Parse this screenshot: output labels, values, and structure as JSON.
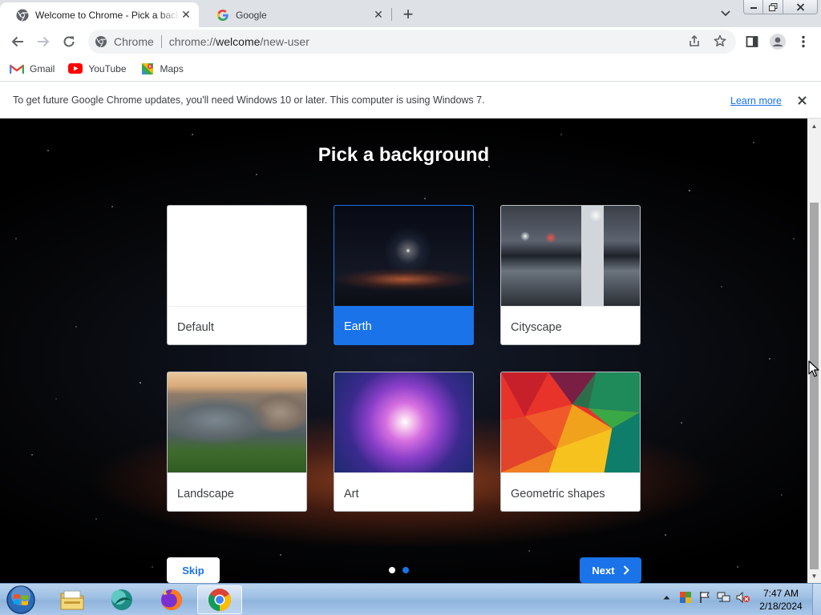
{
  "browser": {
    "tabs": [
      {
        "title": "Welcome to Chrome - Pick a background",
        "favicon": "chrome-logo-icon",
        "active": true
      },
      {
        "title": "Google",
        "favicon": "google-g-icon",
        "active": false
      }
    ],
    "omnibox": {
      "chip": "Chrome",
      "url_prefix": "chrome://",
      "url_host": "welcome",
      "url_path": "/new-user"
    },
    "bookmarks": [
      {
        "label": "Gmail",
        "icon": "gmail-icon"
      },
      {
        "label": "YouTube",
        "icon": "youtube-icon"
      },
      {
        "label": "Maps",
        "icon": "maps-icon"
      }
    ]
  },
  "infobar": {
    "message": "To get future Google Chrome updates, you'll need Windows 10 or later. This computer is using Windows 7.",
    "link": "Learn more"
  },
  "page": {
    "title": "Pick a background",
    "options": [
      {
        "label": "Default",
        "selected": false
      },
      {
        "label": "Earth",
        "selected": true
      },
      {
        "label": "Cityscape",
        "selected": false
      },
      {
        "label": "Landscape",
        "selected": false
      },
      {
        "label": "Art",
        "selected": false
      },
      {
        "label": "Geometric shapes",
        "selected": false
      }
    ],
    "skip_label": "Skip",
    "next_label": "Next",
    "step_current": 2,
    "step_total": 2
  },
  "taskbar": {
    "time": "7:47 AM",
    "date": "2/18/2024",
    "pinned": [
      "windows-explorer-icon",
      "app-icon",
      "firefox-icon",
      "chrome-icon"
    ]
  },
  "colors": {
    "accent": "#1a73e8",
    "tabstrip": "#dee1e6",
    "selected_card": "#1a73e8"
  }
}
